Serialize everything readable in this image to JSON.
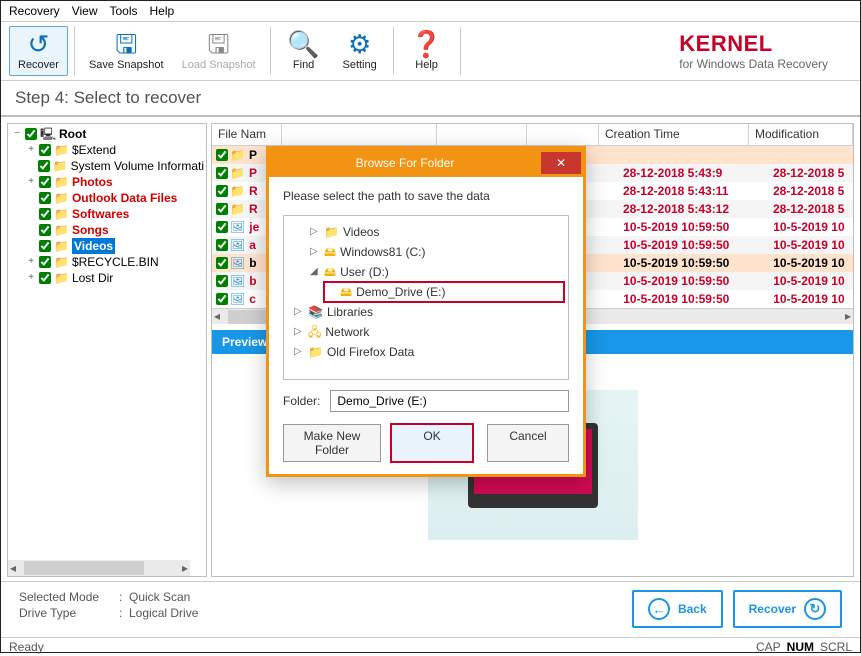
{
  "menu": {
    "recovery": "Recovery",
    "view": "View",
    "tools": "Tools",
    "help": "Help"
  },
  "toolbar": {
    "recover": "Recover",
    "save_snapshot": "Save Snapshot",
    "load_snapshot": "Load Snapshot",
    "find": "Find",
    "setting": "Setting",
    "help": "Help"
  },
  "brand": {
    "name": "KERNEL",
    "sub": "for Windows Data Recovery"
  },
  "step": "Step 4: Select to recover",
  "tree": {
    "root": "Root",
    "items": [
      {
        "label": "$Extend",
        "red": false,
        "exp": "+"
      },
      {
        "label": "System Volume Informati",
        "red": false,
        "exp": ""
      },
      {
        "label": "Photos",
        "red": true,
        "exp": "+"
      },
      {
        "label": "Outlook Data Files",
        "red": true,
        "exp": ""
      },
      {
        "label": "Softwares",
        "red": true,
        "exp": ""
      },
      {
        "label": "Songs",
        "red": true,
        "exp": ""
      },
      {
        "label": "Videos",
        "red": true,
        "exp": "",
        "sel": true
      },
      {
        "label": "$RECYCLE.BIN",
        "red": false,
        "exp": "+"
      },
      {
        "label": "Lost Dir",
        "red": false,
        "exp": "+"
      }
    ]
  },
  "grid": {
    "headers": {
      "name": "File Nam",
      "creation": "Creation Time",
      "modification": "Modification"
    },
    "rows": [
      {
        "ic": "fld",
        "name": "P",
        "ct": "",
        "mt": "",
        "hl": true
      },
      {
        "ic": "fld",
        "name": "P",
        "ct": "28-12-2018 5:43:9",
        "mt": "28-12-2018 5"
      },
      {
        "ic": "fld",
        "name": "R",
        "ct": "28-12-2018 5:43:11",
        "mt": "28-12-2018 5"
      },
      {
        "ic": "fld",
        "name": "R",
        "ct": "28-12-2018 5:43:12",
        "mt": "28-12-2018 5"
      },
      {
        "ic": "img",
        "name": "je",
        "ct": "10-5-2019 10:59:50",
        "mt": "10-5-2019 10"
      },
      {
        "ic": "img",
        "name": "a",
        "ct": "10-5-2019 10:59:50",
        "mt": "10-5-2019 10"
      },
      {
        "ic": "img",
        "name": "b",
        "ct": "10-5-2019 10:59:50",
        "mt": "10-5-2019 10",
        "hl": true,
        "black": true
      },
      {
        "ic": "img",
        "name": "b",
        "ct": "10-5-2019 10:59:50",
        "mt": "10-5-2019 10"
      },
      {
        "ic": "img",
        "name": "c",
        "ct": "10-5-2019 10:59:50",
        "mt": "10-5-2019 10"
      }
    ]
  },
  "preview": {
    "label": "Preview"
  },
  "status": {
    "mode_label": "Selected Mode",
    "mode_value": "Quick Scan",
    "drive_label": "Drive Type",
    "drive_value": "Logical Drive"
  },
  "buttons": {
    "back": "Back",
    "recover": "Recover"
  },
  "statusbar": {
    "ready": "Ready",
    "cap": "CAP",
    "num": "NUM",
    "scrl": "SCRL"
  },
  "dialog": {
    "title": "Browse For Folder",
    "prompt": "Please select the path to save the data",
    "items": [
      {
        "label": "Videos",
        "lvl": 1,
        "exp": "▷",
        "ic": "📁"
      },
      {
        "label": "Windows81 (C:)",
        "lvl": 1,
        "exp": "▷",
        "ic": "🖴"
      },
      {
        "label": "User (D:)",
        "lvl": 1,
        "exp": "◢",
        "ic": "🖴"
      },
      {
        "label": "Demo_Drive (E:)",
        "lvl": 2,
        "exp": "",
        "ic": "🖴",
        "sel": true
      },
      {
        "label": "Libraries",
        "lvl": 0,
        "exp": "▷",
        "ic": "📚"
      },
      {
        "label": "Network",
        "lvl": 0,
        "exp": "▷",
        "ic": "🖧"
      },
      {
        "label": "Old Firefox Data",
        "lvl": 0,
        "exp": "▷",
        "ic": "📁"
      }
    ],
    "folder_label": "Folder:",
    "folder_value": "Demo_Drive (E:)",
    "make_new": "Make New Folder",
    "ok": "OK",
    "cancel": "Cancel"
  }
}
